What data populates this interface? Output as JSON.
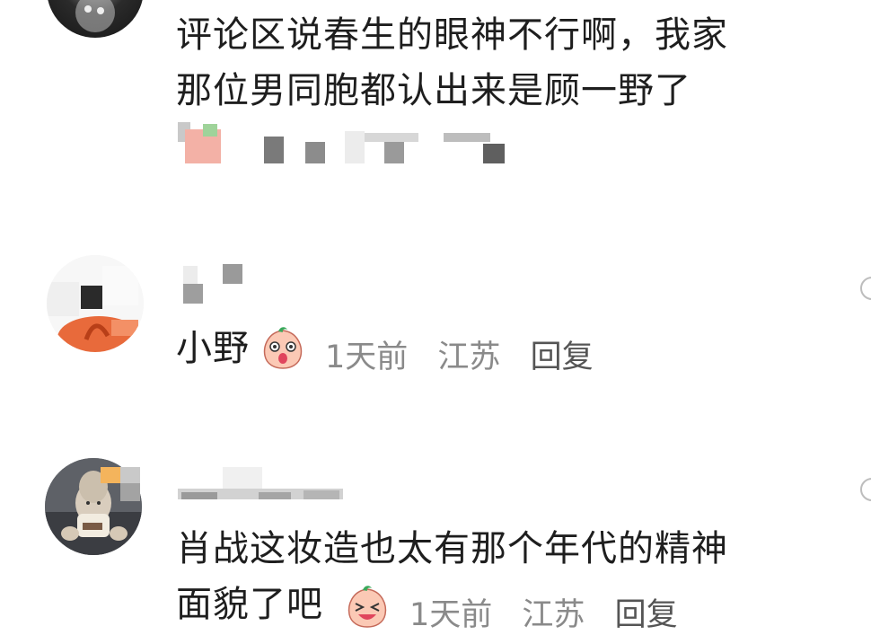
{
  "comments": [
    {
      "text_lines": [
        "评论区说春生的眼神不行啊，我家",
        "那位男同胞都认出来是顾一野了"
      ]
    },
    {
      "text": "小野",
      "meta": {
        "time": "1天前",
        "location": "江苏",
        "reply": "回复"
      }
    },
    {
      "text_lines": [
        "肖战这妆造也太有那个年代的精神",
        "面貌了吧"
      ],
      "meta": {
        "time": "1天前",
        "location": "江苏",
        "reply": "回复"
      }
    }
  ],
  "icons": {
    "emoji_surprised": "peach-face-surprised-icon",
    "emoji_laughing": "peach-face-laughing-icon"
  },
  "colors": {
    "text": "#1e1e1e",
    "meta": "#8a8a8a",
    "background": "#ffffff"
  }
}
